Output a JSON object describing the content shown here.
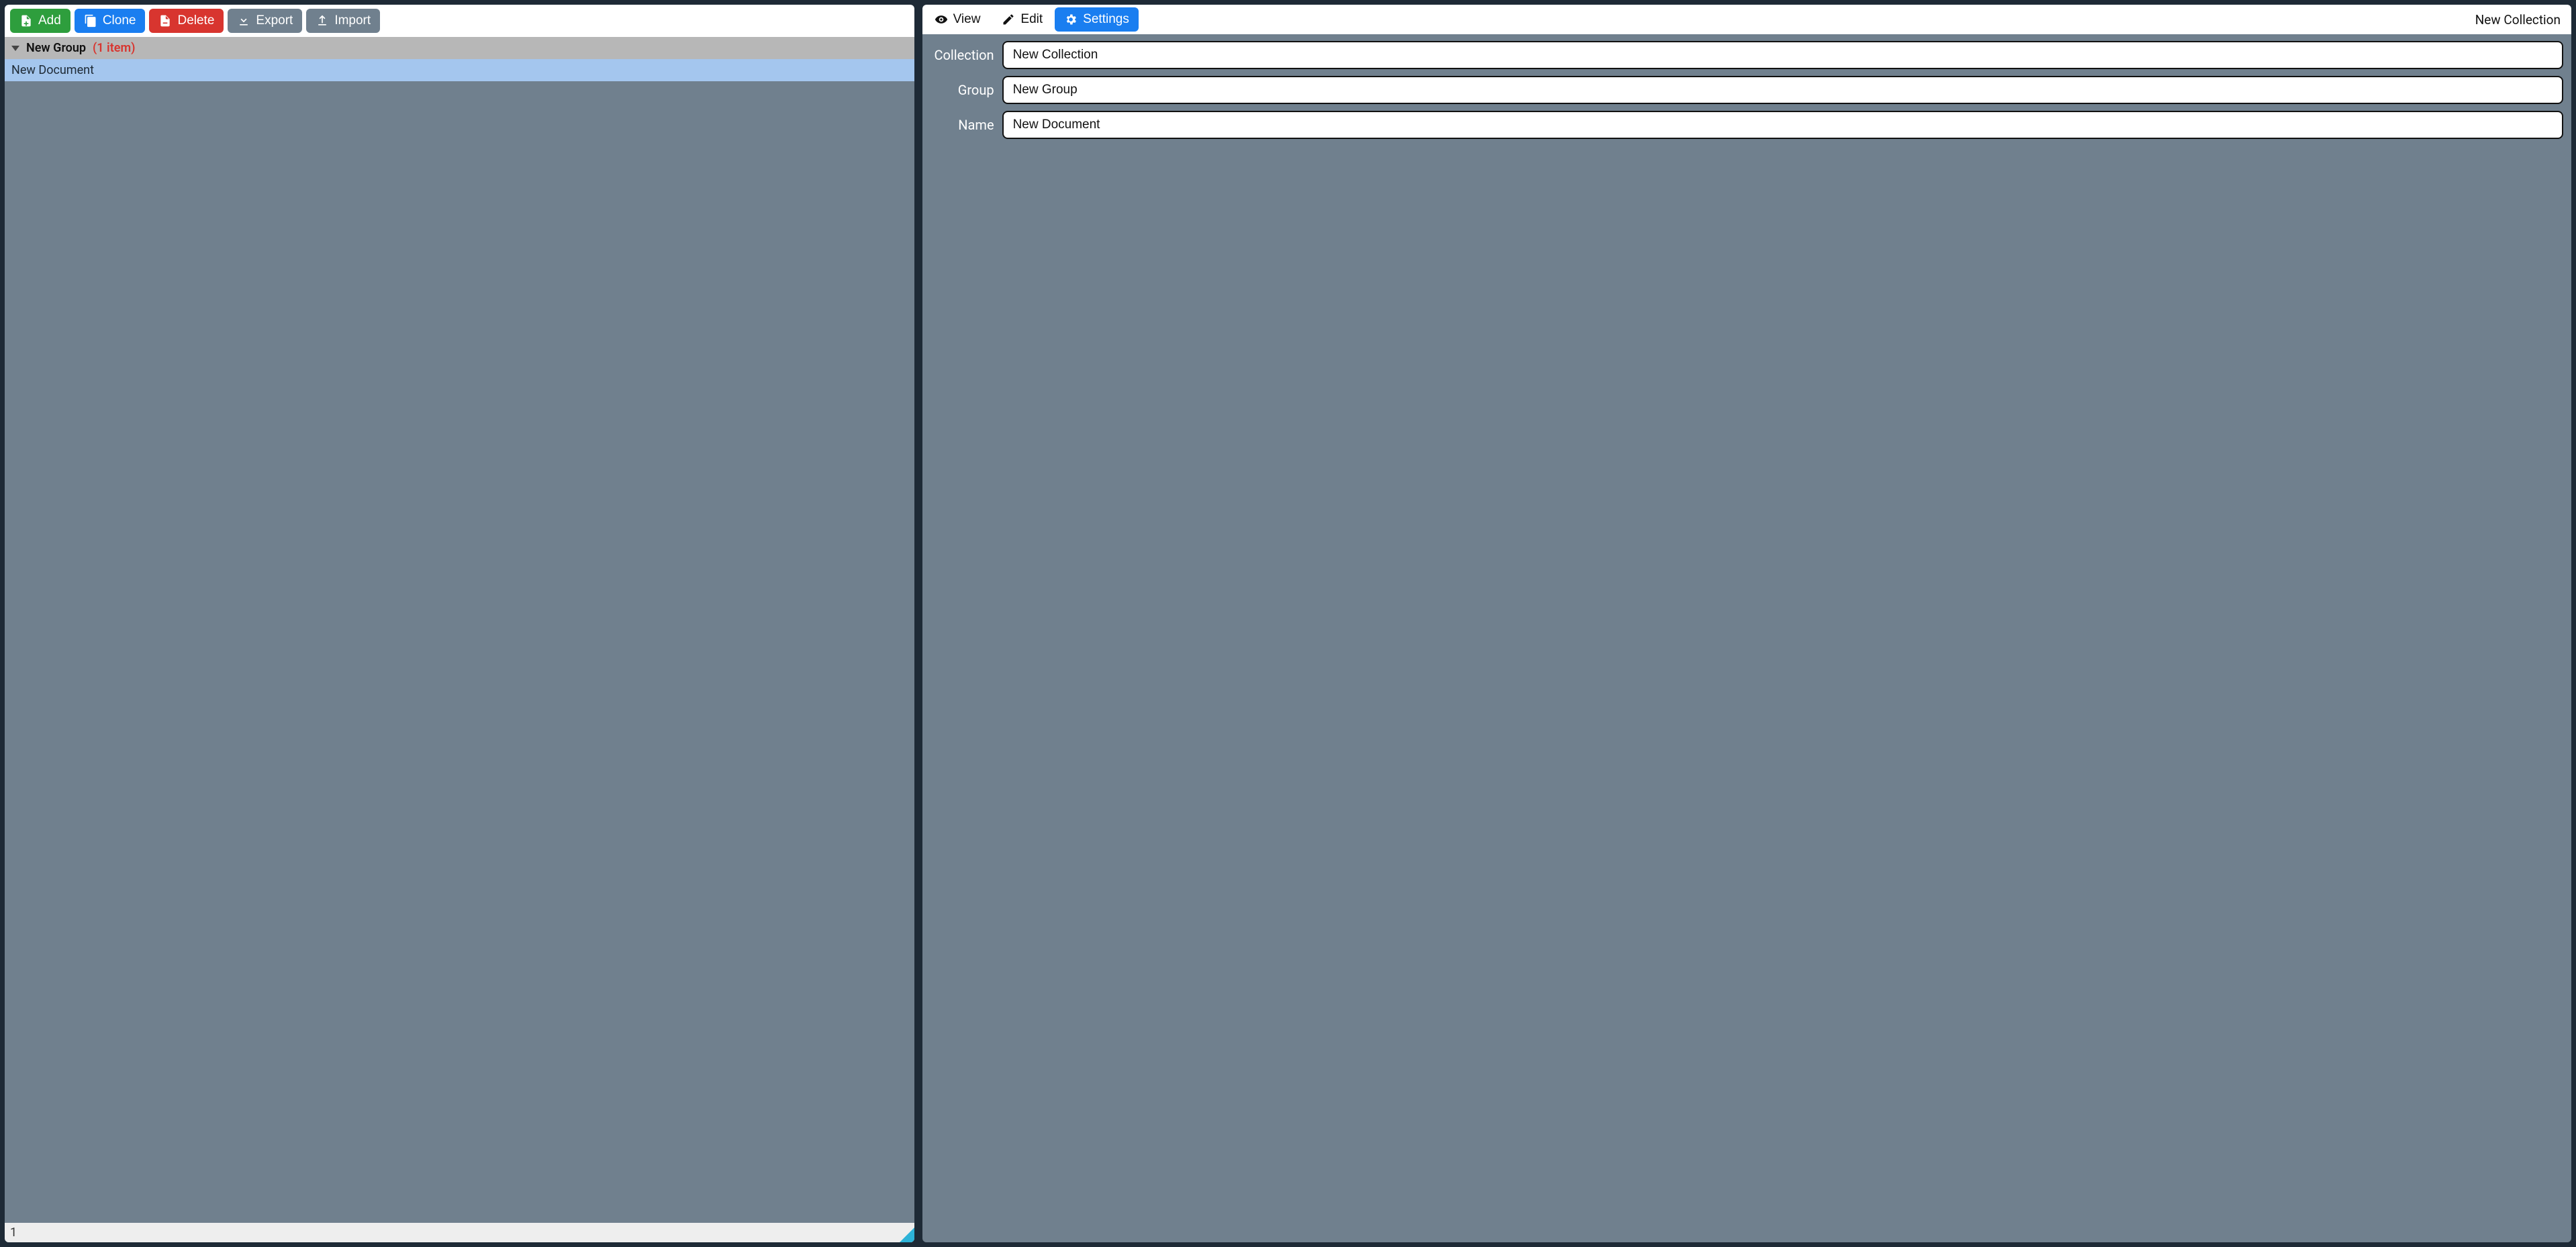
{
  "toolbar": {
    "add": "Add",
    "clone": "Clone",
    "delete": "Delete",
    "export": "Export",
    "import": "Import"
  },
  "sidebar": {
    "group_name": "New Group",
    "group_count": "(1 item)",
    "items": [
      {
        "label": "New Document"
      }
    ],
    "footer_count": "1"
  },
  "tabs": {
    "view": "View",
    "edit": "Edit",
    "settings": "Settings",
    "title": "New Collection"
  },
  "form": {
    "collection_label": "Collection",
    "collection_value": "New Collection",
    "group_label": "Group",
    "group_value": "New Group",
    "name_label": "Name",
    "name_value": "New Document"
  }
}
